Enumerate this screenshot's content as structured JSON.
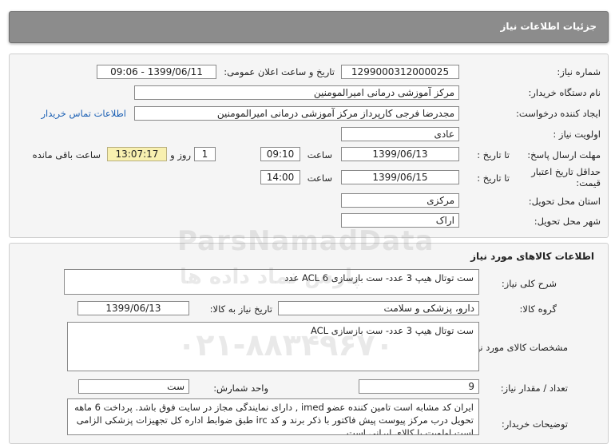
{
  "header": {
    "title": "جزئیات اطلاعات نیاز"
  },
  "details": {
    "need_number_label": "شماره نیاز:",
    "need_number": "1299000312000025",
    "announce_label": "تاریخ و ساعت اعلان عمومی:",
    "announce_value": "1399/06/11 - 09:06",
    "buyer_org_label": "نام دستگاه خریدار:",
    "buyer_org": "مرکز آموزشی درمانی امیرالمومنین",
    "requester_label": "ایجاد کننده درخواست:",
    "requester": "مجدرضا فرجی کارپرداز مرکز آموزشی درمانی امیرالمومنین",
    "contact_link": "اطلاعات تماس خریدار",
    "priority_label": "اولویت نیاز :",
    "priority": "عادی",
    "deadline_label": "مهلت ارسال پاسخ:",
    "to_date_label": "تا تاریخ :",
    "deadline_date": "1399/06/13",
    "time_label": "ساعت",
    "deadline_time": "09:10",
    "days_value": "1",
    "days_label": "روز و",
    "remaining_time": "13:07:17",
    "remaining_label": "ساعت باقی مانده",
    "min_validity_label": "حداقل تاریخ اعتبار قیمت:",
    "validity_date": "1399/06/15",
    "validity_time": "14:00",
    "province_label": "استان محل تحویل:",
    "province": "مرکزی",
    "city_label": "شهر محل تحویل:",
    "city": "اراک"
  },
  "goods": {
    "title": "اطلاعات کالاهای مورد نیاز",
    "summary_label": "شرح کلی نیاز:",
    "summary": "ست توتال هیپ 3 عدد- ست بازسازی ACL 6 عدد",
    "group_label": "گروه کالا:",
    "group": "دارو، پزشکی و سلامت",
    "need_date_label": "تاریخ نیاز به کالا:",
    "need_date": "1399/06/13",
    "specs_label": "مشخصات کالای مورد نیاز:",
    "specs": "ست توتال هیپ 3 عدد- ست بازسازی ACL",
    "quantity_label": "تعداد / مقدار نیاز:",
    "quantity": "9",
    "unit_label": "واحد شمارش:",
    "unit": "ست",
    "buyer_notes_label": "توضیحات خریدار:",
    "buyer_notes": "ایران کد مشابه است تامین کننده عضو imed , دارای نمایندگی مجاز در سایت فوق باشد. پرداخت 6 ماهه تحویل درب مرکز پیوست پیش فاکتور با ذکر برند و کد irc طبق ضوابط اداره کل تجهیزات پزشکی الزامی است اولویت با کالای ایرانی است"
  },
  "watermark": {
    "brand": "ParsNamadData",
    "fa": "پارس نماد داده ها",
    "phone": "۰۲۱-۸۸۳۴۹۶۷۰"
  }
}
